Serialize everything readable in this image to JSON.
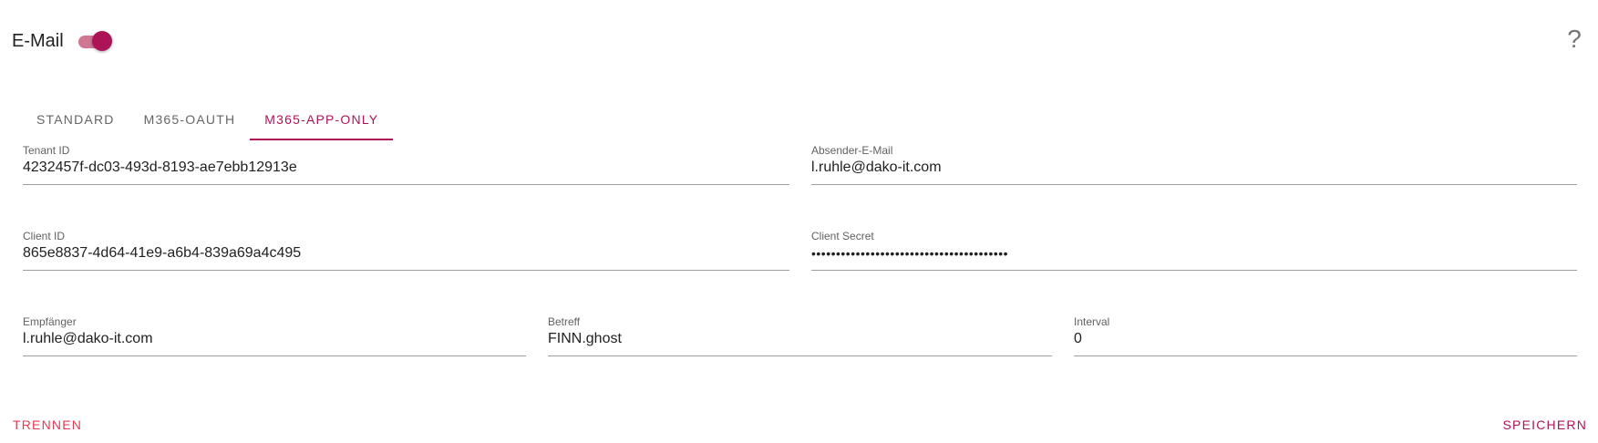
{
  "header": {
    "title": "E-Mail",
    "toggle_on": true,
    "help_symbol": "?"
  },
  "tabs": [
    {
      "label": "STANDARD",
      "active": false
    },
    {
      "label": "M365-OAUTH",
      "active": false
    },
    {
      "label": "M365-APP-ONLY",
      "active": true
    }
  ],
  "form": {
    "tenant_id": {
      "label": "Tenant ID",
      "value": "4232457f-dc03-493d-8193-ae7ebb12913e"
    },
    "sender_email": {
      "label": "Absender-E-Mail",
      "value": "l.ruhle@dako-it.com"
    },
    "client_id": {
      "label": "Client ID",
      "value": "865e8837-4d64-41e9-a6b4-839a69a4c495"
    },
    "client_secret": {
      "label": "Client Secret",
      "value": "••••••••••••••••••••••••••••••••••••••••"
    },
    "recipient": {
      "label": "Empfänger",
      "value": "l.ruhle@dako-it.com"
    },
    "subject": {
      "label": "Betreff",
      "value": "FINN.ghost"
    },
    "interval": {
      "label": "Interval",
      "value": "0"
    }
  },
  "actions": {
    "disconnect_label": "TRENNEN",
    "save_label": "SPEICHERN"
  },
  "colors": {
    "accent": "#ad1457",
    "danger": "#e53950"
  },
  "icons": {
    "help": "help-icon"
  }
}
